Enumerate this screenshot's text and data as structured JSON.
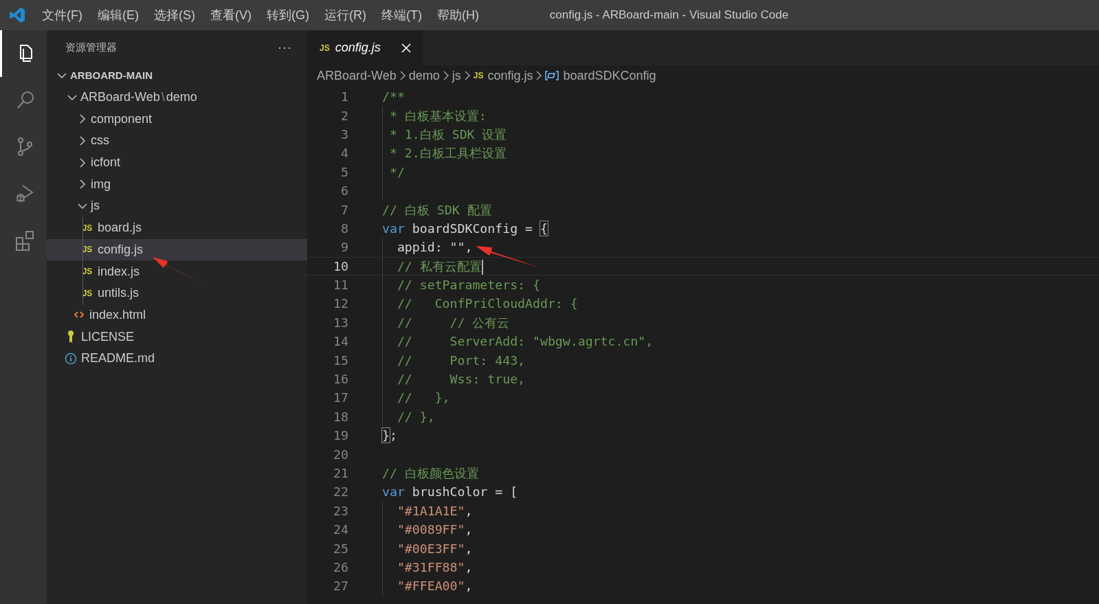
{
  "title_bar": {
    "menu": [
      "文件(F)",
      "编辑(E)",
      "选择(S)",
      "查看(V)",
      "转到(G)",
      "运行(R)",
      "终端(T)",
      "帮助(H)"
    ],
    "title": "config.js - ARBoard-main - Visual Studio Code"
  },
  "activity_bar": [
    {
      "kind": "explorer",
      "selected": true
    },
    {
      "kind": "search",
      "selected": false
    },
    {
      "kind": "source-control",
      "selected": false
    },
    {
      "kind": "debug",
      "selected": false
    },
    {
      "kind": "extensions",
      "selected": false
    }
  ],
  "sidebar": {
    "title": "资源管理器",
    "more": "···",
    "tree": [
      {
        "label": "ARBOARD-MAIN",
        "kind": "root",
        "expanded": true,
        "selected": false,
        "children": [
          {
            "label": "ARBoard-Web",
            "separator": "\\",
            "compact": "demo",
            "kind": "folder",
            "expanded": true,
            "selected": false,
            "children": [
              {
                "label": "component",
                "kind": "folder",
                "expanded": false,
                "selected": false
              },
              {
                "label": "css",
                "kind": "folder",
                "expanded": false,
                "selected": false
              },
              {
                "label": "icfont",
                "kind": "folder",
                "expanded": false,
                "selected": false
              },
              {
                "label": "img",
                "kind": "folder",
                "expanded": false,
                "selected": false
              },
              {
                "label": "js",
                "kind": "folder",
                "expanded": true,
                "selected": false,
                "children": [
                  {
                    "label": "board.js",
                    "kind": "js",
                    "icon": "JS",
                    "selected": false
                  },
                  {
                    "label": "config.js",
                    "kind": "js",
                    "icon": "JS",
                    "selected": true
                  },
                  {
                    "label": "index.js",
                    "kind": "js",
                    "icon": "JS",
                    "selected": false
                  },
                  {
                    "label": "untils.js",
                    "kind": "js",
                    "icon": "JS",
                    "selected": false
                  }
                ]
              },
              {
                "label": "index.html",
                "kind": "html",
                "selected": false
              }
            ]
          },
          {
            "label": "LICENSE",
            "kind": "license",
            "selected": false
          },
          {
            "label": "README.md",
            "kind": "info",
            "selected": false
          }
        ]
      }
    ]
  },
  "tabs": [
    {
      "label": "config.js",
      "kind": "js",
      "icon": "JS",
      "selected": true,
      "preview": true
    }
  ],
  "breadcrumbs": [
    {
      "label": "ARBoard-Web",
      "kind": "folder"
    },
    {
      "label": "demo",
      "kind": "folder"
    },
    {
      "label": "js",
      "kind": "folder"
    },
    {
      "label": "config.js",
      "kind": "js",
      "icon": "JS"
    },
    {
      "label": "boardSDKConfig",
      "kind": "symbol"
    }
  ],
  "lines": [
    {
      "number": "1",
      "tokens": [
        {
          "kind": "comment",
          "text": "/**"
        }
      ]
    },
    {
      "number": "2",
      "guide": true,
      "tokens": [
        {
          "kind": "comment",
          "text": " * 白板基本设置:"
        }
      ]
    },
    {
      "number": "3",
      "guide": true,
      "tokens": [
        {
          "kind": "comment",
          "text": " * 1.白板 SDK 设置"
        }
      ]
    },
    {
      "number": "4",
      "guide": true,
      "tokens": [
        {
          "kind": "comment",
          "text": " * 2.白板工具栏设置"
        }
      ]
    },
    {
      "number": "5",
      "guide": true,
      "tokens": [
        {
          "kind": "comment",
          "text": " */"
        }
      ]
    },
    {
      "number": "6",
      "guide": true
    },
    {
      "number": "7",
      "tokens": [
        {
          "kind": "comment",
          "text": "// 白板 SDK 配置"
        }
      ]
    },
    {
      "number": "8",
      "tokens": [
        {
          "kind": "keyword",
          "text": "var"
        },
        {
          "kind": "text",
          "text": " boardSDKConfig = "
        },
        {
          "kind": "bracket-match",
          "text": "{"
        }
      ]
    },
    {
      "number": "9",
      "guide": true,
      "tokens": [
        {
          "kind": "text",
          "text": "  appid: \"\","
        }
      ]
    },
    {
      "number": "10",
      "guide": true,
      "current": true,
      "tokens": [
        {
          "kind": "comment",
          "text": "  // 私有云配置"
        }
      ]
    },
    {
      "number": "11",
      "guide": true,
      "tokens": [
        {
          "kind": "comment",
          "text": "  // setParameters: {"
        }
      ]
    },
    {
      "number": "12",
      "guide": true,
      "tokens": [
        {
          "kind": "comment",
          "text": "  //   ConfPriCloudAddr: {"
        }
      ]
    },
    {
      "number": "13",
      "guide": true,
      "tokens": [
        {
          "kind": "comment",
          "text": "  //     // 公有云"
        }
      ]
    },
    {
      "number": "14",
      "guide": true,
      "tokens": [
        {
          "kind": "comment",
          "text": "  //     ServerAdd: \"wbgw.agrtc.cn\","
        }
      ]
    },
    {
      "number": "15",
      "guide": true,
      "tokens": [
        {
          "kind": "comment",
          "text": "  //     Port: 443,"
        }
      ]
    },
    {
      "number": "16",
      "guide": true,
      "tokens": [
        {
          "kind": "comment",
          "text": "  //     Wss: true,"
        }
      ]
    },
    {
      "number": "17",
      "guide": true,
      "tokens": [
        {
          "kind": "comment",
          "text": "  //   },"
        }
      ]
    },
    {
      "number": "18",
      "guide": true,
      "tokens": [
        {
          "kind": "comment",
          "text": "  // },"
        }
      ]
    },
    {
      "number": "19",
      "tokens": [
        {
          "kind": "bracket-match",
          "text": "}"
        },
        {
          "kind": "text",
          "text": ";"
        }
      ]
    },
    {
      "number": "20"
    },
    {
      "number": "21",
      "tokens": [
        {
          "kind": "comment",
          "text": "// 白板颜色设置"
        }
      ]
    },
    {
      "number": "22",
      "tokens": [
        {
          "kind": "keyword",
          "text": "var"
        },
        {
          "kind": "text",
          "text": " brushColor = ["
        }
      ]
    },
    {
      "number": "23",
      "guide": true,
      "tokens": [
        {
          "kind": "string",
          "text": "  \"#1A1A1E\""
        },
        {
          "kind": "text",
          "text": ","
        }
      ]
    },
    {
      "number": "24",
      "guide": true,
      "tokens": [
        {
          "kind": "string",
          "text": "  \"#0089FF\""
        },
        {
          "kind": "text",
          "text": ","
        }
      ]
    },
    {
      "number": "25",
      "guide": true,
      "tokens": [
        {
          "kind": "string",
          "text": "  \"#00E3FF\""
        },
        {
          "kind": "text",
          "text": ","
        }
      ]
    },
    {
      "number": "26",
      "guide": true,
      "tokens": [
        {
          "kind": "string",
          "text": "  \"#31FF88\""
        },
        {
          "kind": "text",
          "text": ","
        }
      ]
    },
    {
      "number": "27",
      "guide": true,
      "tokens": [
        {
          "kind": "string",
          "text": "  \"#FFEA00\""
        },
        {
          "kind": "text",
          "text": ","
        }
      ]
    }
  ]
}
